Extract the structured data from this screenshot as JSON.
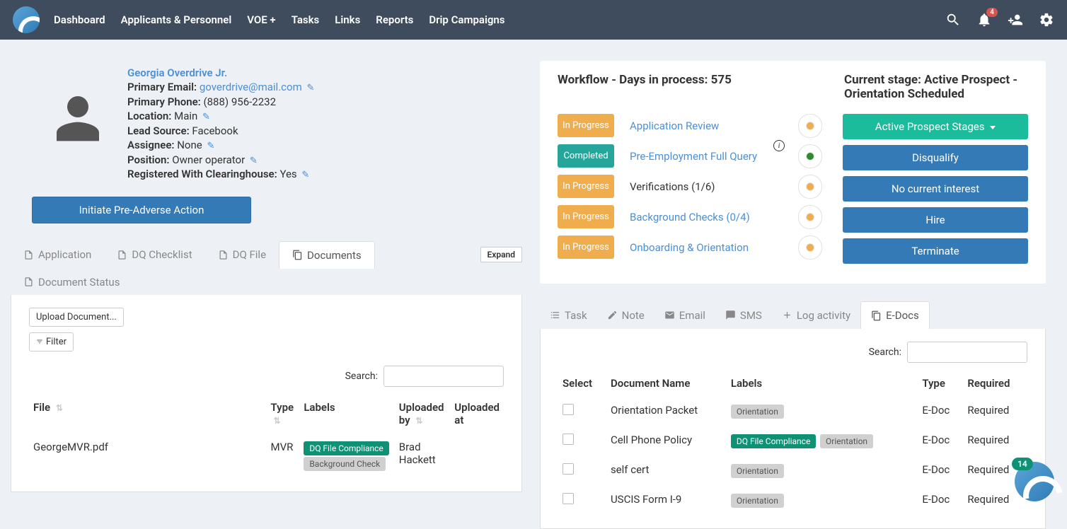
{
  "nav": {
    "items": [
      "Dashboard",
      "Applicants & Personnel",
      "VOE +",
      "Tasks",
      "Links",
      "Reports",
      "Drip Campaigns"
    ],
    "notif_count": "4"
  },
  "profile": {
    "name": "Georgia Overdrive Jr.",
    "email_label": "Primary Email:",
    "email": "goverdrive@mail.com",
    "phone_label": "Primary Phone:",
    "phone": "(888) 956-2232",
    "location_label": "Location:",
    "location": "Main",
    "lead_label": "Lead Source:",
    "lead": "Facebook",
    "assignee_label": "Assignee:",
    "assignee": "None",
    "position_label": "Position:",
    "position": "Owner operator",
    "reg_label": "Registered With Clearinghouse:",
    "reg": "Yes",
    "action_btn": "Initiate Pre-Adverse Action"
  },
  "workflow": {
    "title": "Workflow - Days in process: 575",
    "stage_title": "Current stage: Active Prospect - Orientation Scheduled",
    "steps": [
      {
        "status": "In Progress",
        "label": "Application Review",
        "link": true,
        "dot": "orange"
      },
      {
        "status": "Completed",
        "label": "Pre-Employment Full Query",
        "link": true,
        "dot": "green",
        "info": true
      },
      {
        "status": "In Progress",
        "label": "Verifications (1/6)",
        "link": false,
        "dot": "orange"
      },
      {
        "status": "In Progress",
        "label": "Background Checks (0/4)",
        "link": true,
        "dot": "orange"
      },
      {
        "status": "In Progress",
        "label": "Onboarding & Orientation",
        "link": true,
        "dot": "orange"
      }
    ],
    "actions": [
      "Active Prospect Stages",
      "Disqualify",
      "No current interest",
      "Hire",
      "Terminate"
    ]
  },
  "left_tabs": {
    "items": [
      {
        "label": "Application",
        "icon": "doc"
      },
      {
        "label": "DQ Checklist",
        "icon": "doc"
      },
      {
        "label": "DQ File",
        "icon": "doc"
      },
      {
        "label": "Documents",
        "icon": "copy",
        "active": true
      },
      {
        "label": "Document Status",
        "icon": "doc"
      }
    ],
    "expand": "Expand"
  },
  "documents": {
    "upload_btn": "Upload Document...",
    "filter_btn": "Filter",
    "search_label": "Search:",
    "columns": [
      "File",
      "Type",
      "Labels",
      "Uploaded by",
      "Uploaded at"
    ],
    "rows": [
      {
        "file": "GeorgeMVR.pdf",
        "type": "MVR",
        "labels": [
          "DQ File Compliance",
          "Background Check"
        ],
        "by": "Brad Hackett"
      }
    ]
  },
  "right_tabs": {
    "items": [
      {
        "label": "Task",
        "icon": "list"
      },
      {
        "label": "Note",
        "icon": "edit"
      },
      {
        "label": "Email",
        "icon": "mail"
      },
      {
        "label": "SMS",
        "icon": "chat"
      },
      {
        "label": "Log activity",
        "icon": "plus"
      },
      {
        "label": "E-Docs",
        "icon": "copy",
        "active": true
      }
    ]
  },
  "edocs": {
    "search_label": "Search:",
    "columns": [
      "Select",
      "Document Name",
      "Labels",
      "Type",
      "Required"
    ],
    "rows": [
      {
        "name": "Orientation Packet",
        "labels": [
          {
            "text": "Orientation",
            "style": "gray"
          }
        ],
        "type": "E-Doc",
        "req": "Required"
      },
      {
        "name": "Cell Phone Policy",
        "labels": [
          {
            "text": "DQ File Compliance",
            "style": "green"
          },
          {
            "text": "Orientation",
            "style": "gray"
          }
        ],
        "type": "E-Doc",
        "req": "Required"
      },
      {
        "name": "self cert",
        "labels": [
          {
            "text": "Orientation",
            "style": "gray"
          }
        ],
        "type": "E-Doc",
        "req": "Required"
      },
      {
        "name": "USCIS Form I-9",
        "labels": [
          {
            "text": "Orientation",
            "style": "gray"
          }
        ],
        "type": "E-Doc",
        "req": "Required"
      }
    ]
  },
  "float_badge": "14"
}
